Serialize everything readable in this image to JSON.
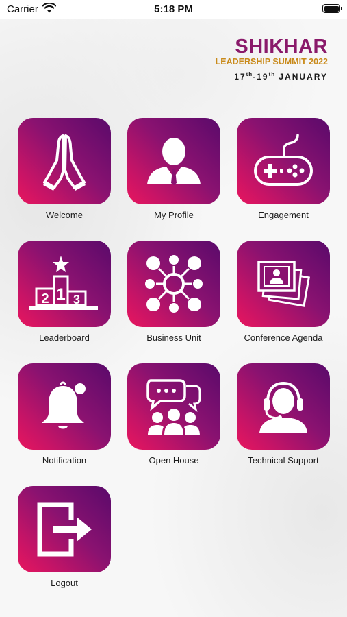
{
  "status_bar": {
    "carrier": "Carrier",
    "time": "5:18 PM"
  },
  "branding": {
    "title": "SHIKHAR",
    "subtitle": "LEADERSHIP SUMMIT 2022",
    "dates_start": "17",
    "dates_start_suffix": "th",
    "dates_end": "-19",
    "dates_end_suffix": "th",
    "dates_month": " JANUARY",
    "brand_color": "#8a1a6a",
    "accent_color": "#c98a1a"
  },
  "menu": {
    "tile_gradient": [
      "#5a0a6b",
      "#e8165e"
    ],
    "items": [
      {
        "label": "Welcome",
        "icon": "praying-hands-icon"
      },
      {
        "label": "My Profile",
        "icon": "person-icon"
      },
      {
        "label": "Engagement",
        "icon": "gamepad-icon"
      },
      {
        "label": "Leaderboard",
        "icon": "podium-icon"
      },
      {
        "label": "Business Unit",
        "icon": "network-icon"
      },
      {
        "label": "Conference Agenda",
        "icon": "photos-icon"
      },
      {
        "label": "Notification",
        "icon": "bell-icon"
      },
      {
        "label": "Open House",
        "icon": "group-chat-icon"
      },
      {
        "label": "Technical Support",
        "icon": "headset-icon"
      },
      {
        "label": "Logout",
        "icon": "logout-icon"
      }
    ]
  }
}
